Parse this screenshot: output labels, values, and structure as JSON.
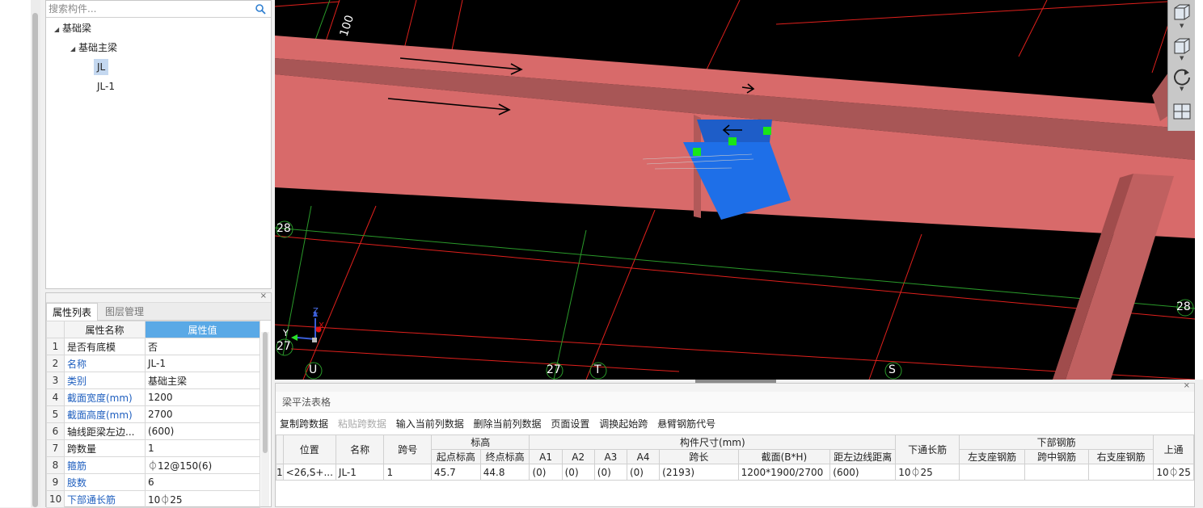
{
  "tree": {
    "search_placeholder": "搜索构件...",
    "items": [
      {
        "label": "基础梁",
        "level": 0,
        "expanded": true,
        "selected": false
      },
      {
        "label": "基础主梁",
        "level": 1,
        "expanded": true,
        "selected": false
      },
      {
        "label": "JL",
        "level": 2,
        "selected": true
      },
      {
        "label": "JL-1",
        "level": 2,
        "selected": false
      }
    ]
  },
  "props": {
    "tabs": [
      "属性列表",
      "图层管理"
    ],
    "active_tab": "属性列表",
    "headers": [
      "属性名称",
      "属性值"
    ],
    "rows": [
      {
        "n": "1",
        "name": "是否有底模",
        "value": "否",
        "blue": false
      },
      {
        "n": "2",
        "name": "名称",
        "value": "JL-1",
        "blue": true
      },
      {
        "n": "3",
        "name": "类别",
        "value": "基础主梁",
        "blue": true
      },
      {
        "n": "4",
        "name": "截面宽度(mm)",
        "value": "1200",
        "blue": true
      },
      {
        "n": "5",
        "name": "截面高度(mm)",
        "value": "2700",
        "blue": true
      },
      {
        "n": "6",
        "name": "轴线距梁左边...",
        "value": "(600)",
        "blue": false
      },
      {
        "n": "7",
        "name": "跨数量",
        "value": "1",
        "blue": false
      },
      {
        "n": "8",
        "name": "箍筋",
        "value": "⏀12@150(6)",
        "blue": true
      },
      {
        "n": "9",
        "name": "肢数",
        "value": "6",
        "blue": true
      },
      {
        "n": "10",
        "name": "下部通长筋",
        "value": "10⏀25",
        "blue": true
      }
    ]
  },
  "viewport": {
    "axis_labels": {
      "u": "U",
      "t": "T",
      "s": "S",
      "n27": "27",
      "n27b": "27",
      "n28": "28",
      "n28b": "28",
      "dim100": "100"
    },
    "coord": {
      "x": "X",
      "y": "Y",
      "z": "Z"
    }
  },
  "beam_table": {
    "title": "梁平法表格",
    "toolbar": [
      {
        "label": "复制跨数据",
        "enabled": true
      },
      {
        "label": "粘贴跨数据",
        "enabled": false
      },
      {
        "label": "输入当前列数据",
        "enabled": true
      },
      {
        "label": "删除当前列数据",
        "enabled": true
      },
      {
        "label": "页面设置",
        "enabled": true
      },
      {
        "label": "调换起始跨",
        "enabled": true
      },
      {
        "label": "悬臂钢筋代号",
        "enabled": true
      }
    ],
    "group_headers": {
      "elev": "标高",
      "size": "构件尺寸(mm)",
      "bottom": "下部钢筋"
    },
    "headers": {
      "pos": "位置",
      "name": "名称",
      "span": "跨号",
      "start": "起点标高",
      "end": "终点标高",
      "a1": "A1",
      "a2": "A2",
      "a3": "A3",
      "a4": "A4",
      "len": "跨长",
      "sec": "截面(B*H)",
      "dist": "距左边线距离",
      "through": "下通长筋",
      "left": "左支座钢筋",
      "mid": "跨中钢筋",
      "right": "右支座钢筋",
      "top": "上通"
    },
    "row": {
      "n": "1",
      "pos": "<26,S+...",
      "name": "JL-1",
      "span": "1",
      "start": "45.7",
      "end": "44.8",
      "a1": "(0)",
      "a2": "(0)",
      "a3": "(0)",
      "a4": "(0)",
      "len": "(2193)",
      "sec": "1200*1900/2700",
      "dist": "(600)",
      "through": "10⏀25",
      "left": "",
      "mid": "",
      "right": "",
      "top": "10⏀25"
    }
  },
  "colors": {
    "beam": "#d86a6a",
    "beam_top": "#a85656",
    "selected": "#1e6fe8",
    "grid_red": "#e0201c",
    "grid_green": "#2a9a2a",
    "grip": "#19e619",
    "header_blue": "#5aa9e6"
  }
}
